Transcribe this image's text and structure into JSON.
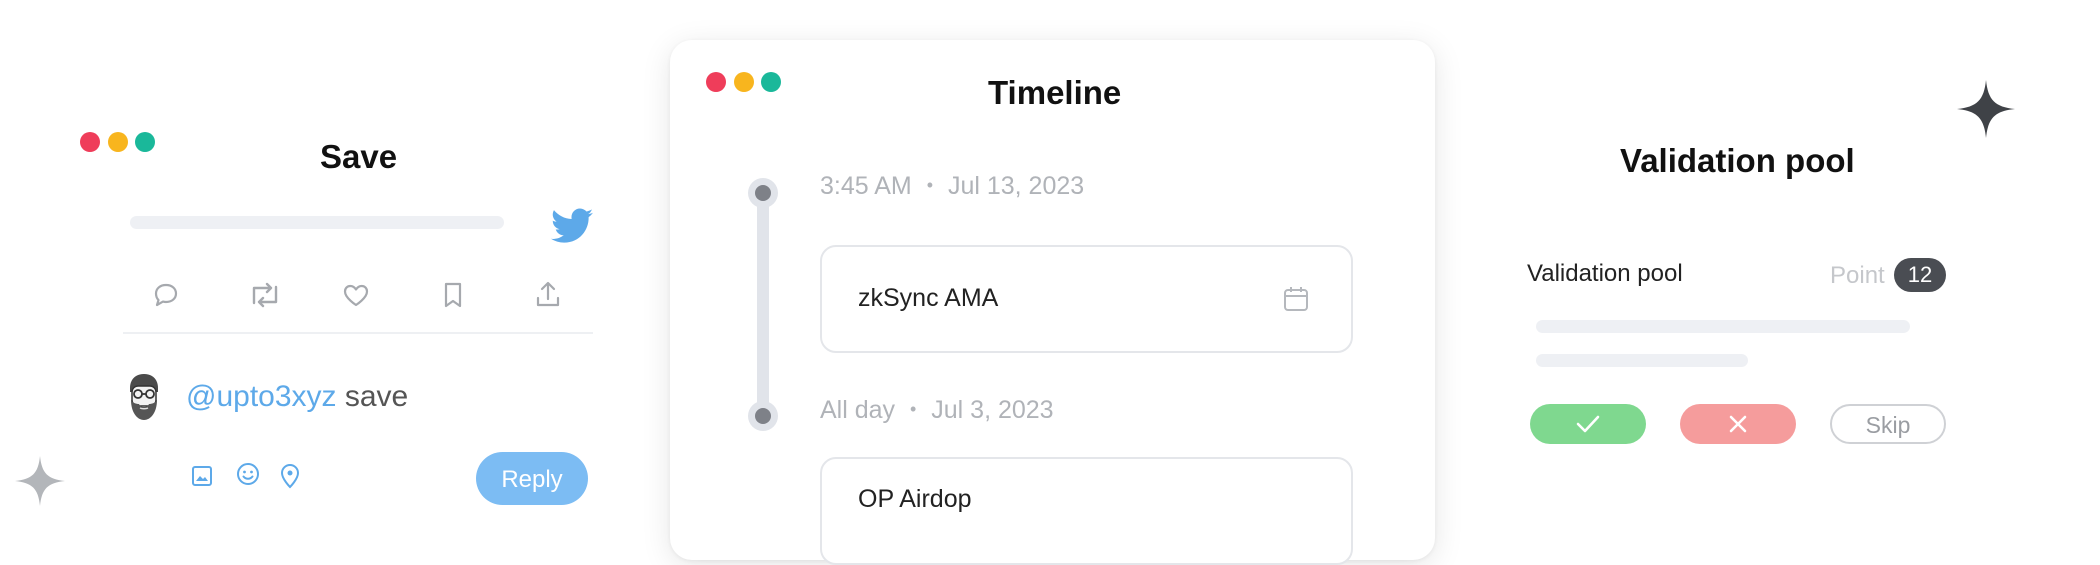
{
  "save_card": {
    "title": "Save",
    "icon_brand": "twitter-bird-icon",
    "actions": [
      "reply-icon",
      "retweet-icon",
      "like-icon",
      "bookmark-icon",
      "share-icon"
    ],
    "reply": {
      "mention": "@upto3xyz",
      "text": "save",
      "tools": [
        "image-icon",
        "emoji-icon",
        "location-icon"
      ],
      "button_label": "Reply"
    }
  },
  "timeline_card": {
    "title": "Timeline",
    "items": [
      {
        "time": "3:45 AM",
        "separator": "•",
        "date": "Jul 13, 2023",
        "event": "zkSync AMA",
        "icon": "calendar-icon"
      },
      {
        "time": "All day",
        "separator": "•",
        "date": "Jul 3, 2023",
        "event": "OP Airdop"
      }
    ]
  },
  "validation_card": {
    "title": "Validation pool",
    "row_label": "Validation pool",
    "point_label": "Point",
    "point_value": "12",
    "buttons": {
      "approve_icon": "check-icon",
      "reject_icon": "close-icon",
      "skip_label": "Skip"
    }
  },
  "colors": {
    "window_red": "#ef3d5a",
    "window_yellow": "#f8b51e",
    "window_green": "#1ab89a",
    "twitter_blue": "#5da9e9",
    "approve_green": "#7fd88f",
    "reject_red": "#f59c9c"
  }
}
